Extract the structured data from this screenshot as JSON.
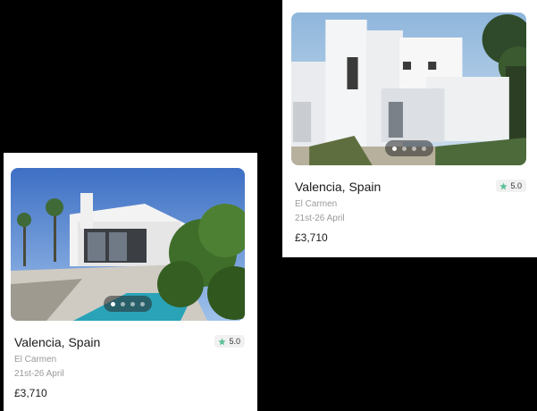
{
  "listings": [
    {
      "title": "Valencia, Spain",
      "area": "El Carmen",
      "dates": "21st-26 April",
      "price": "£3,710",
      "rating": "5.0",
      "image_icon": "white-modern-villa-photo",
      "carousel": {
        "total": 4,
        "active": 1
      }
    },
    {
      "title": "Valencia, Spain",
      "area": "El Carmen",
      "dates": "21st-26 April",
      "price": "£3,710",
      "rating": "5.0",
      "image_icon": "villa-pool-photo",
      "carousel": {
        "total": 4,
        "active": 1
      }
    }
  ],
  "colors": {
    "star": "#5bbf96",
    "background": "#000000",
    "card": "#ffffff"
  }
}
